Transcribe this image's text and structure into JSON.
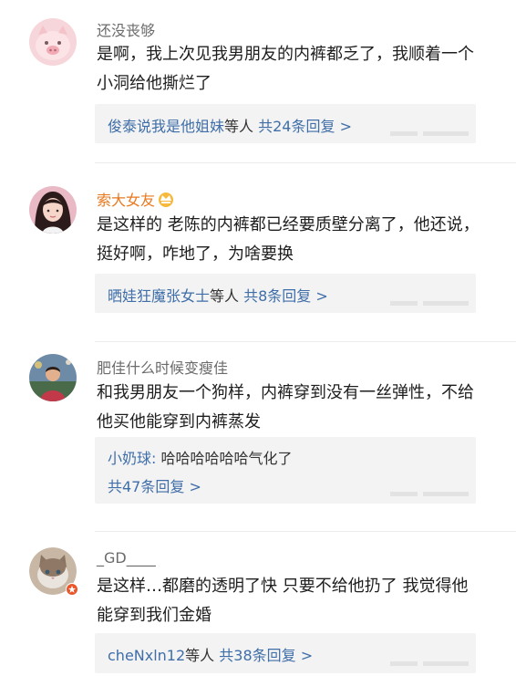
{
  "comments": [
    {
      "username": "还没丧够",
      "text": "是啊，我上次见我男朋友的内裤都乏了，我顺着一个小洞给他撕烂了",
      "reply": {
        "names": "俊泰说我是他姐妹",
        "suffix": "等人",
        "count": "共24条回复 >"
      }
    },
    {
      "username": "索大女友",
      "badge_icon": "crown-badge-icon",
      "text": "是这样的 老陈的内裤都已经要质壁分离了，他还说，挺好啊，咋地了，为啥要换",
      "reply": {
        "names": "晒娃狂魔张女士",
        "suffix": "等人",
        "count": "共8条回复 >"
      }
    },
    {
      "username": "肥佳什么时候变瘦佳",
      "text": "和我男朋友一个狗样，内裤穿到没有一丝弹性，不给他买他能穿到内裤蒸发",
      "reply": {
        "author": "小奶球:",
        "content": " 哈哈哈哈哈哈气化了",
        "count": "共47条回复 >"
      }
    },
    {
      "username": "_GD____",
      "text": "是这样…都磨的透明了快 只要不给他扔了 我觉得他能穿到我们金婚",
      "reply": {
        "names": "cheNxln12",
        "suffix": "等人",
        "count": "共38条回复 >"
      }
    }
  ],
  "colors": {
    "link": "#3f6ea8",
    "username": "#6b6b6b",
    "vip_username": "#e8791f",
    "reply_bg": "#f3f3f3"
  }
}
